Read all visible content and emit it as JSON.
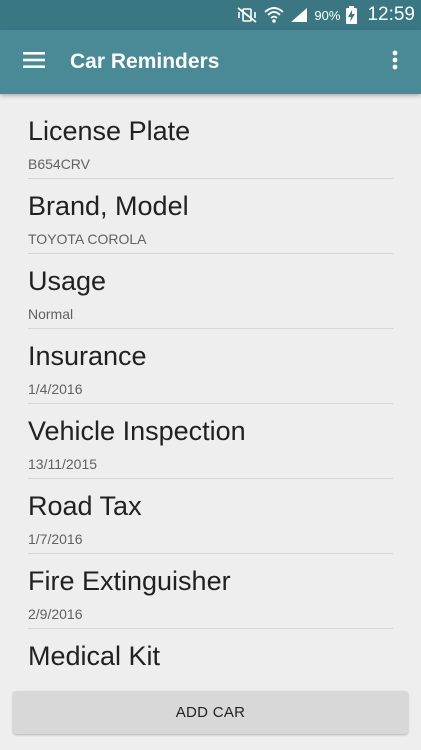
{
  "status_bar": {
    "battery_text": "90%",
    "time": "12:59",
    "icons": [
      "mute-vibrate-icon",
      "wifi-icon",
      "cell-signal-icon",
      "battery-charging-icon"
    ],
    "background_color": "#3A7783"
  },
  "app_bar": {
    "title": "Car Reminders",
    "menu_icon": "hamburger-menu-icon",
    "overflow_icon": "more-vert-icon",
    "background_color": "#4A8A96"
  },
  "list": {
    "items": [
      {
        "title": "License Plate",
        "subtitle": "B654CRV"
      },
      {
        "title": "Brand, Model",
        "subtitle": "TOYOTA COROLA"
      },
      {
        "title": "Usage",
        "subtitle": "Normal"
      },
      {
        "title": "Insurance",
        "subtitle": "1/4/2016"
      },
      {
        "title": "Vehicle Inspection",
        "subtitle": "13/11/2015"
      },
      {
        "title": "Road Tax",
        "subtitle": "1/7/2016"
      },
      {
        "title": "Fire Extinguisher",
        "subtitle": "2/9/2016"
      },
      {
        "title": "Medical Kit",
        "subtitle": ""
      }
    ]
  },
  "footer": {
    "add_car_label": "ADD CAR"
  }
}
